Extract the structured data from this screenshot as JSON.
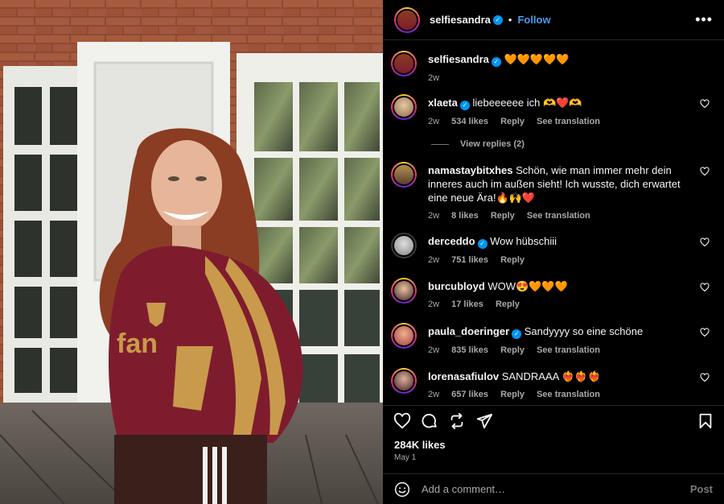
{
  "header": {
    "username": "selfiesandra",
    "separator": "•",
    "follow_label": "Follow",
    "more_label": "•••"
  },
  "caption": {
    "username": "selfiesandra",
    "text": "🧡🧡🧡🧡🧡",
    "time": "2w"
  },
  "comments": [
    {
      "username": "xlaeta",
      "verified": true,
      "text": "liebeeeeee ich 🫶❤️🫶",
      "time": "2w",
      "likes": "534 likes",
      "reply": "Reply",
      "translate": "See translation"
    },
    {
      "username": "namastaybitxhes",
      "verified": false,
      "text": "Schön, wie man immer mehr dein inneres auch im außen sieht! Ich wusste, dich erwartet eine neue Ära!🔥🙌❤️",
      "time": "2w",
      "likes": "8 likes",
      "reply": "Reply",
      "translate": "See translation"
    },
    {
      "username": "derceddo",
      "verified": true,
      "text": "Wow hübschiii",
      "time": "2w",
      "likes": "751 likes",
      "reply": "Reply",
      "translate": ""
    },
    {
      "username": "burcubloyd",
      "verified": false,
      "text": "WOW😍🧡🧡🧡",
      "time": "2w",
      "likes": "17 likes",
      "reply": "Reply",
      "translate": ""
    },
    {
      "username": "paula_doeringer",
      "verified": true,
      "text": "Sandyyyy so eine schöne",
      "time": "2w",
      "likes": "835 likes",
      "reply": "Reply",
      "translate": "See translation"
    },
    {
      "username": "lorenasafiulov",
      "verified": false,
      "text": "SANDRAAA ❤️‍🔥❤️‍🔥❤️‍🔥",
      "time": "2w",
      "likes": "657 likes",
      "reply": "Reply",
      "translate": "See translation"
    }
  ],
  "view_replies": "View replies (2)",
  "actions": {
    "icons": [
      "heart-icon",
      "comment-icon",
      "repost-icon",
      "share-icon",
      "bookmark-icon"
    ]
  },
  "likes_count": "284K likes",
  "post_date": "May 1",
  "composer": {
    "placeholder": "Add a comment…",
    "post_label": "Post"
  },
  "colors": {
    "accent": "#4f99f7",
    "verified": "#0095f6",
    "background": "#000000",
    "muted": "#a8a8a8"
  }
}
